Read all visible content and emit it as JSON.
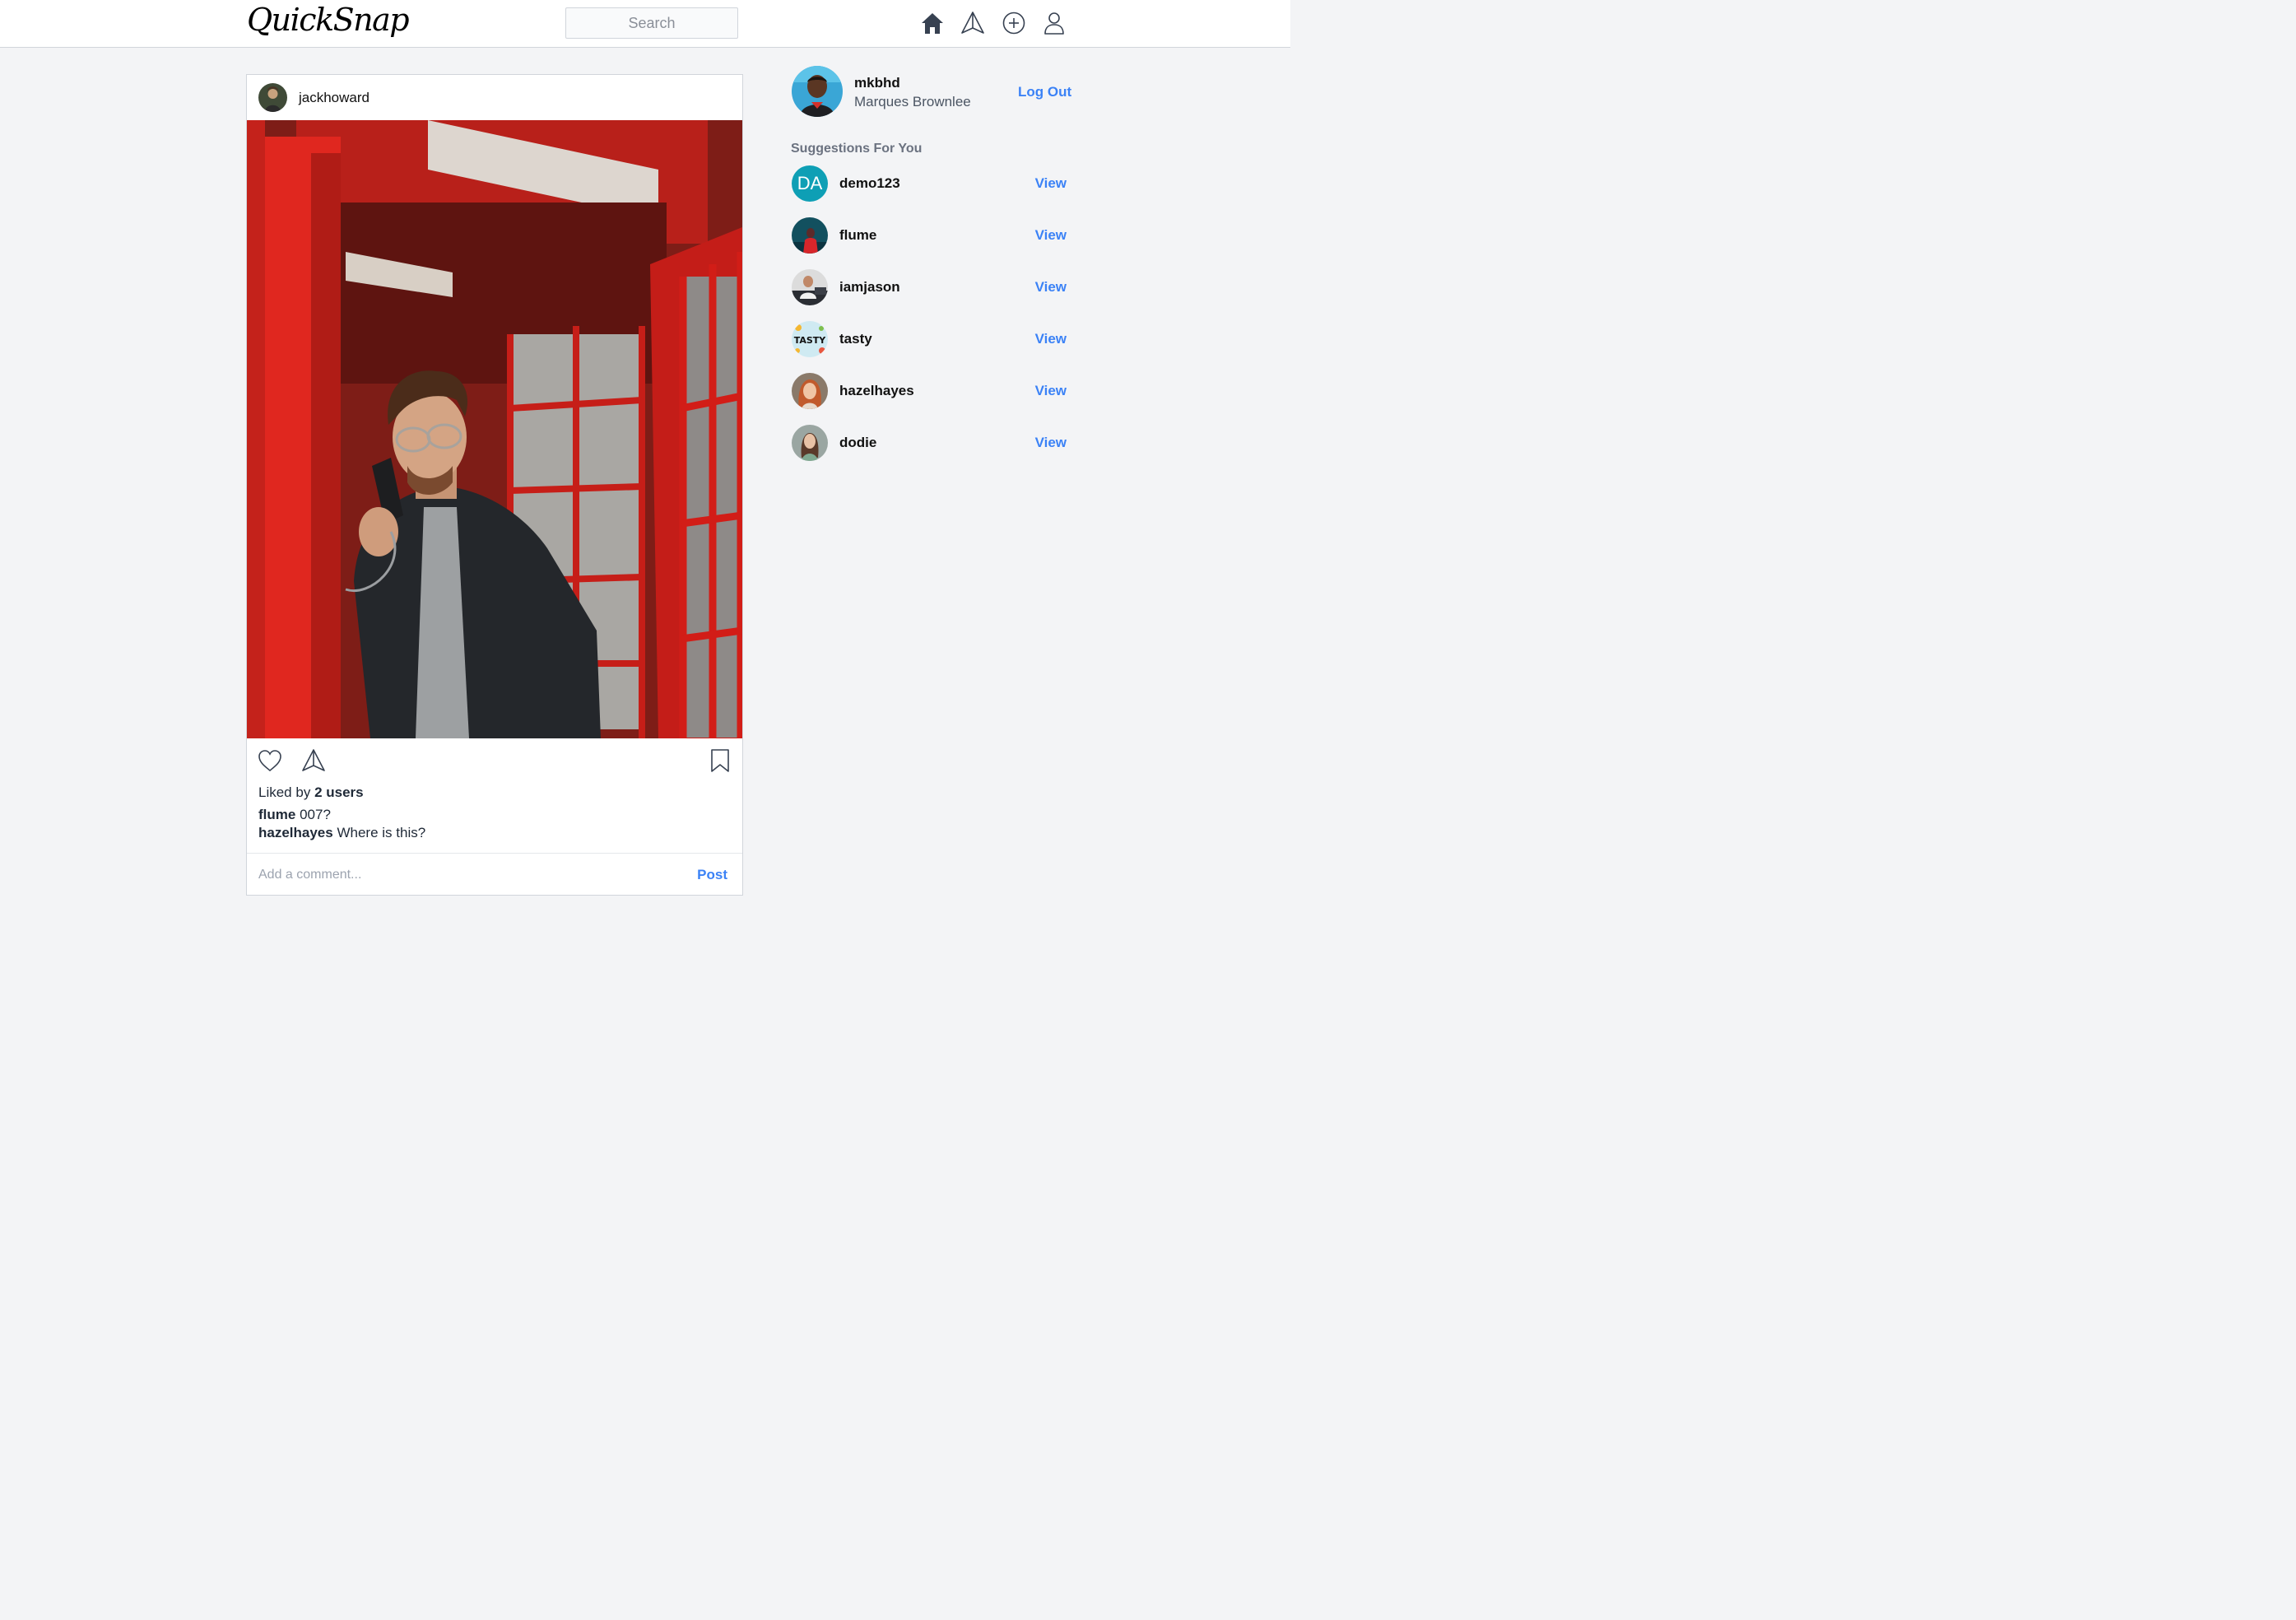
{
  "header": {
    "logo": "QuickSnap",
    "search_placeholder": "Search",
    "icons": [
      "home-icon",
      "explore-icon",
      "add-post-icon",
      "profile-icon"
    ]
  },
  "post": {
    "username": "jackhoward",
    "liked_prefix": "Liked by",
    "liked_count": "2 users",
    "comments": [
      {
        "user": "flume",
        "text": "007?"
      },
      {
        "user": "hazelhayes",
        "text": "Where is this?"
      }
    ],
    "comment_placeholder": "Add a comment...",
    "post_label": "Post"
  },
  "sidebar": {
    "username": "mkbhd",
    "full_name": "Marques Brownlee",
    "logout_label": "Log Out",
    "suggestions_title": "Suggestions For You",
    "suggestions": [
      {
        "username": "demo123",
        "initials": "DA",
        "view": "View"
      },
      {
        "username": "flume",
        "view": "View"
      },
      {
        "username": "iamjason",
        "view": "View"
      },
      {
        "username": "tasty",
        "avatar_text": "TASTY",
        "view": "View"
      },
      {
        "username": "hazelhayes",
        "view": "View"
      },
      {
        "username": "dodie",
        "view": "View"
      }
    ]
  },
  "colors": {
    "accent": "#3b82f6",
    "background": "#f3f4f6",
    "phone_box_red": "#d4211c"
  }
}
